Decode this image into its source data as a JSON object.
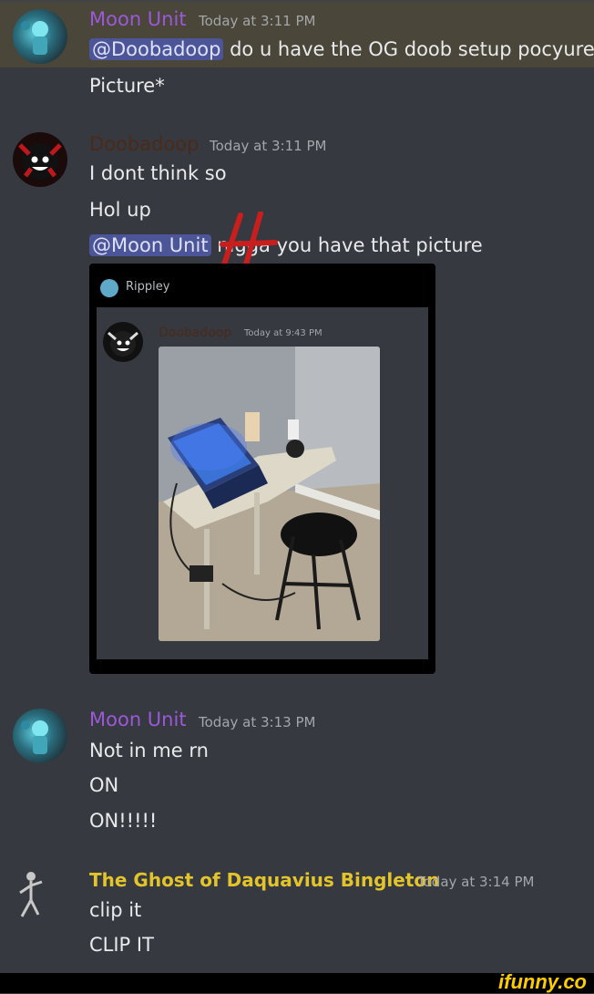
{
  "colors": {
    "bg": "#36393f",
    "mention_bg": "#4b5597",
    "moon_unit": "#9b59d8",
    "doobadoop": "#4a2a1a",
    "ghost": "#e3c52b",
    "timestamp": "#a3a6aa"
  },
  "messages": [
    {
      "user": "Moon Unit",
      "time": "Today at 3:11 PM",
      "lines": [
        {
          "mention": "@Doobadoop",
          "text": " do u have the OG doob setup pocyure"
        },
        {
          "text": "Picture*"
        }
      ]
    },
    {
      "user": "Doobadoop",
      "time": "Today at 3:11 PM",
      "lines": [
        {
          "text": "I dont think so"
        },
        {
          "text": "Hol up"
        },
        {
          "mention": "@Moon Unit",
          "text": " nigga you have that picture"
        }
      ]
    },
    {
      "user": "Moon Unit",
      "time": "Today at 3:13 PM",
      "lines": [
        {
          "text": "Not in me rn"
        },
        {
          "text": "ON"
        },
        {
          "text": "ON!!!!!"
        }
      ]
    },
    {
      "user": "The Ghost of Daquavius Bingleton",
      "time": "Today at 3:14 PM",
      "lines": [
        {
          "text": "clip it"
        },
        {
          "text": "CLIP IT"
        }
      ]
    }
  ],
  "embed": {
    "author": "Rippley",
    "inner_user": "Doobadoop",
    "inner_time": "Today at 9:43 PM"
  },
  "overlay": {
    "mark": "H"
  },
  "watermark": "ifunny.co"
}
